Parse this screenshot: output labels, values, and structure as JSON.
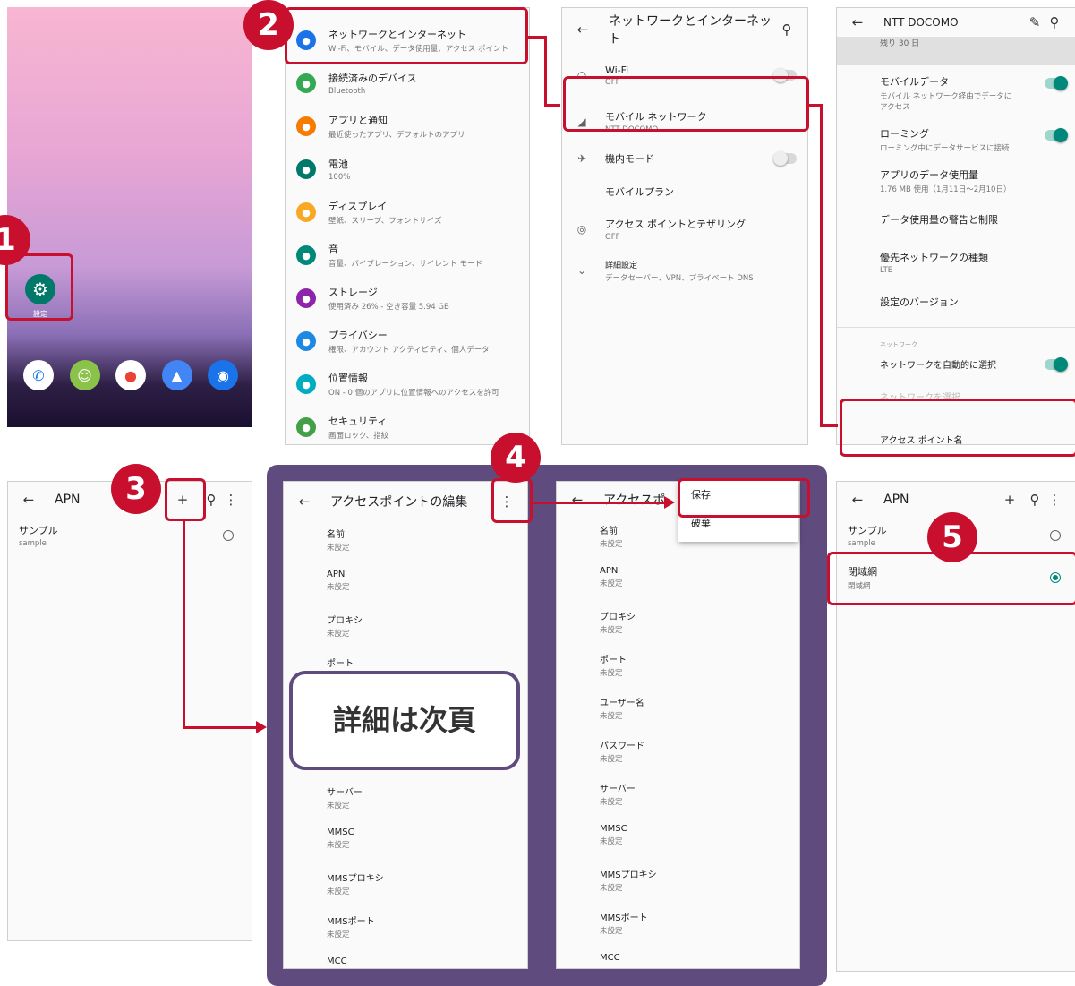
{
  "home": {
    "settings_label": "設定"
  },
  "settings": {
    "items": [
      {
        "title": "ネットワークとインターネット",
        "sub": "Wi-Fi、モバイル、データ使用量、アクセス ポイント",
        "color": "#1a73e8",
        "icon": "wifi-icon"
      },
      {
        "title": "接続済みのデバイス",
        "sub": "Bluetooth",
        "color": "#34a853",
        "icon": "devices-icon"
      },
      {
        "title": "アプリと通知",
        "sub": "最近使ったアプリ、デフォルトのアプリ",
        "color": "#f57c00",
        "icon": "apps-icon"
      },
      {
        "title": "電池",
        "sub": "100%",
        "color": "#00796b",
        "icon": "battery-icon"
      },
      {
        "title": "ディスプレイ",
        "sub": "壁紙、スリープ、フォントサイズ",
        "color": "#f9a825",
        "icon": "display-icon"
      },
      {
        "title": "音",
        "sub": "音量、バイブレーション、サイレント モード",
        "color": "#00897b",
        "icon": "sound-icon"
      },
      {
        "title": "ストレージ",
        "sub": "使用済み 26% - 空き容量 5.94 GB",
        "color": "#8e24aa",
        "icon": "storage-icon"
      },
      {
        "title": "プライバシー",
        "sub": "権限、アカウント アクティビティ、個人データ",
        "color": "#1e88e5",
        "icon": "privacy-icon"
      },
      {
        "title": "位置情報",
        "sub": "ON - 0 個のアプリに位置情報へのアクセスを許可",
        "color": "#00acc1",
        "icon": "location-icon"
      },
      {
        "title": "セキュリティ",
        "sub": "画面ロック、指紋",
        "color": "#43a047",
        "icon": "security-icon"
      }
    ]
  },
  "network": {
    "title": "ネットワークとインターネット",
    "wifi": {
      "title": "Wi-Fi",
      "sub": "OFF"
    },
    "mobile": {
      "title": "モバイル ネットワーク",
      "sub": "NTT DOCOMO"
    },
    "airplane": {
      "title": "機内モード"
    },
    "plan": {
      "title": "モバイルプラン"
    },
    "hotspot": {
      "title": "アクセス ポイントとテザリング",
      "sub": "OFF"
    },
    "advanced": {
      "title": "詳細設定",
      "sub": "データセーバー、VPN、プライベート DNS"
    }
  },
  "docomo": {
    "title": "NTT DOCOMO",
    "remaining": "残り 30 日",
    "mobile_data": {
      "title": "モバイルデータ",
      "sub": "モバイル ネットワーク経由でデータにアクセス"
    },
    "roaming": {
      "title": "ローミング",
      "sub": "ローミング中にデータサービスに接続"
    },
    "app_usage": {
      "title": "アプリのデータ使用量",
      "sub": "1.76 MB 使用（1月11日～2月10日）"
    },
    "warning": "データ使用量の警告と制限",
    "preferred": {
      "title": "優先ネットワークの種類",
      "sub": "LTE"
    },
    "version": "設定のバージョン",
    "section": "ネットワーク",
    "auto_select": "ネットワークを自動的に選択",
    "select": "ネットワークを選択",
    "apn": "アクセス ポイント名"
  },
  "apn_list": {
    "title": "APN",
    "sample": {
      "title": "サンプル",
      "sub": "sample"
    }
  },
  "apn_edit": {
    "title": "アクセスポイントの編集",
    "title_cut": "アクセスポ",
    "fields": [
      {
        "label": "名前",
        "value": "未設定"
      },
      {
        "label": "APN",
        "value": "未設定"
      },
      {
        "label": "プロキシ",
        "value": "未設定"
      },
      {
        "label": "ポート",
        "value": "未設定"
      },
      {
        "label": "ユーザー名",
        "value": "未設定"
      },
      {
        "label": "パスワード",
        "value": "未設定"
      },
      {
        "label": "サーバー",
        "value": "未設定"
      },
      {
        "label": "MMSC",
        "value": "未設定"
      },
      {
        "label": "MMSプロキシ",
        "value": "未設定"
      },
      {
        "label": "MMSポート",
        "value": "未設定"
      },
      {
        "label": "MCC",
        "value": ""
      }
    ],
    "menu_save": "保存",
    "menu_discard": "破棄"
  },
  "callout": "詳細は次頁",
  "apn_list2": {
    "title": "APN",
    "sample": {
      "title": "サンプル",
      "sub": "sample"
    },
    "closed": {
      "title": "閉域網",
      "sub": "閉域網"
    }
  },
  "steps": [
    "1",
    "2",
    "3",
    "4",
    "5"
  ],
  "colors": {
    "accent": "#c8102e",
    "purple": "#5f4b7e",
    "teal": "#00897b"
  }
}
